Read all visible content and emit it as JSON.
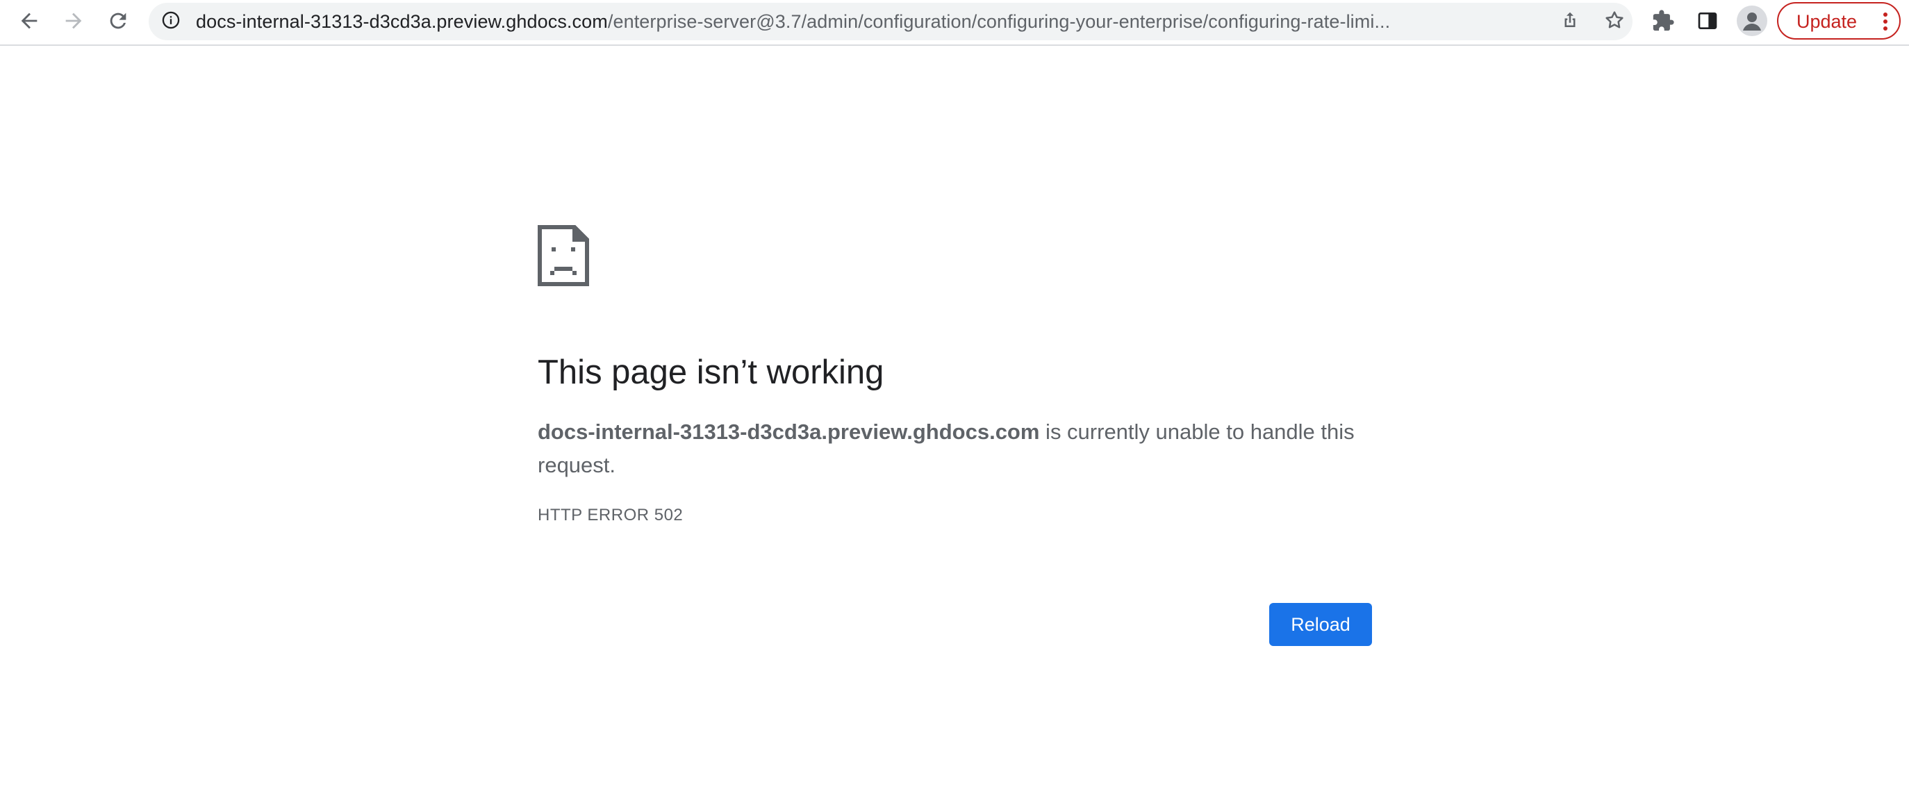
{
  "browser": {
    "back_icon": "arrow-left-icon",
    "forward_icon": "arrow-right-icon",
    "reload_icon": "reload-icon",
    "site_info_icon": "info-icon",
    "url_host": "docs-internal-31313-d3cd3a.preview.ghdocs.com",
    "url_path": "/enterprise-server@3.7/admin/configuration/configuring-your-enterprise/configuring-rate-limi...",
    "share_icon": "share-icon",
    "bookmark_icon": "star-icon",
    "extensions_icon": "puzzle-icon",
    "side_panel_icon": "side-panel-icon",
    "profile_icon": "person-icon",
    "update_label": "Update",
    "menu_icon": "kebab-menu-icon",
    "update_color": "#c5221f"
  },
  "error_page": {
    "icon": "sad-document-icon",
    "title": "This page isn’t working",
    "host": "docs-internal-31313-d3cd3a.preview.ghdocs.com",
    "message": " is currently unable to handle this request.",
    "error_code": "HTTP ERROR 502",
    "reload_label": "Reload",
    "reload_color": "#1a73e8"
  }
}
